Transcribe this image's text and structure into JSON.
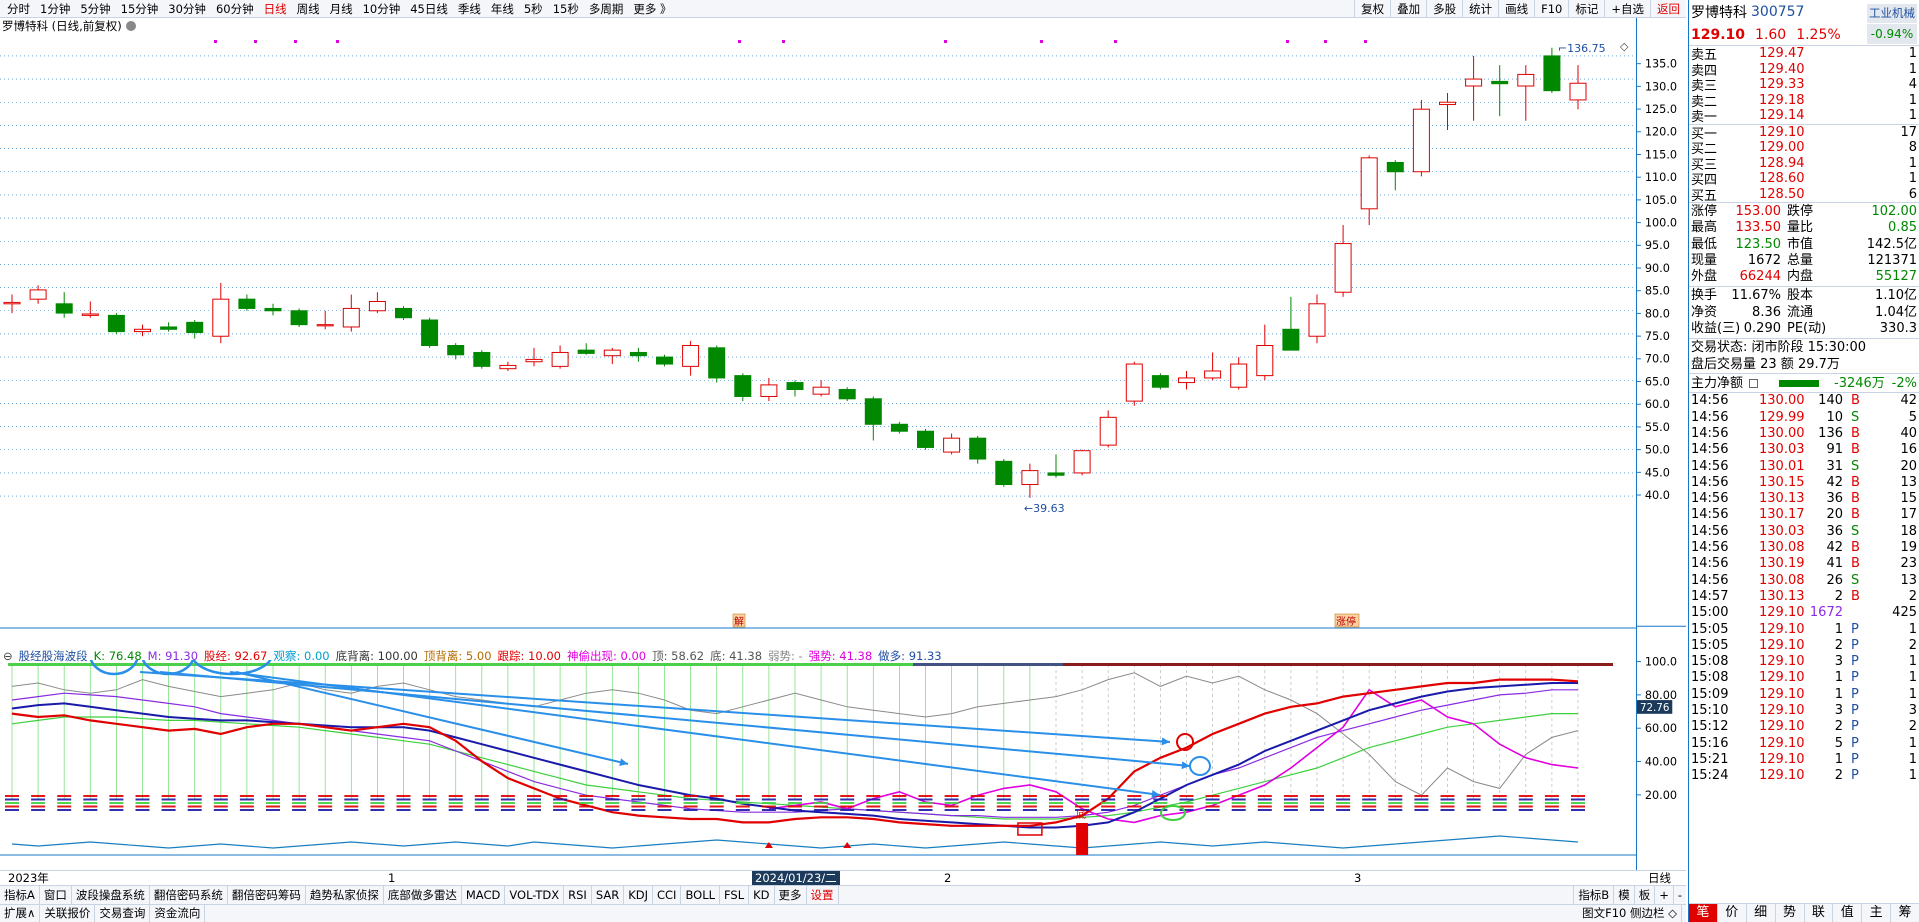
{
  "toolbar": {
    "timeframes": [
      "分时",
      "1分钟",
      "5分钟",
      "15分钟",
      "30分钟",
      "60分钟",
      "日线",
      "周线",
      "月线",
      "10分钟",
      "45日线",
      "季线",
      "年线",
      "5秒",
      "15秒",
      "多周期",
      "更多 》"
    ],
    "active_timeframe": "日线",
    "right_buttons": [
      "复权",
      "叠加",
      "多股",
      "统计",
      "画线",
      "F10",
      "标记",
      "+自选",
      "返回"
    ]
  },
  "chart": {
    "title": "罗博特科 (日线,前复权)",
    "high_label": "136.75",
    "low_label": "39.63",
    "yaxis_labels": [
      "135.0",
      "130.0",
      "125.0",
      "120.0",
      "115.0",
      "110.0",
      "105.0",
      "100.0",
      "95.0",
      "90.0",
      "85.0",
      "80.0",
      "75.0",
      "70.0",
      "65.0",
      "60.0",
      "55.0",
      "50.0",
      "45.0",
      "40.0"
    ],
    "price_min": 37,
    "price_max": 138,
    "event_markers": [
      "解",
      "涨停"
    ],
    "candles": [
      {
        "o": 81.5,
        "h": 83.5,
        "l": 79.5,
        "c": 81.8
      },
      {
        "o": 82.5,
        "h": 85.5,
        "l": 81.5,
        "c": 84.5
      },
      {
        "o": 81.5,
        "h": 84,
        "l": 78.5,
        "c": 79.5
      },
      {
        "o": 79,
        "h": 82,
        "l": 78.5,
        "c": 79.3
      },
      {
        "o": 79,
        "h": 79.5,
        "l": 75,
        "c": 75.5
      },
      {
        "o": 75.5,
        "h": 77,
        "l": 74.5,
        "c": 76
      },
      {
        "o": 76.5,
        "h": 77.5,
        "l": 75.5,
        "c": 76
      },
      {
        "o": 77.5,
        "h": 78,
        "l": 74,
        "c": 75.3
      },
      {
        "o": 74.5,
        "h": 86,
        "l": 73,
        "c": 82.5
      },
      {
        "o": 82.5,
        "h": 83.5,
        "l": 80,
        "c": 80.5
      },
      {
        "o": 80.5,
        "h": 81.5,
        "l": 79,
        "c": 80
      },
      {
        "o": 80,
        "h": 80.5,
        "l": 76.5,
        "c": 77
      },
      {
        "o": 77,
        "h": 80,
        "l": 76,
        "c": 77
      },
      {
        "o": 76.5,
        "h": 83.5,
        "l": 75.5,
        "c": 80.5
      },
      {
        "o": 80,
        "h": 84,
        "l": 79.5,
        "c": 82
      },
      {
        "o": 80.5,
        "h": 81,
        "l": 78,
        "c": 78.5
      },
      {
        "o": 78,
        "h": 78.5,
        "l": 72,
        "c": 72.5
      },
      {
        "o": 72.5,
        "h": 73,
        "l": 69.5,
        "c": 70.5
      },
      {
        "o": 71,
        "h": 71.5,
        "l": 67.5,
        "c": 68
      },
      {
        "o": 67.5,
        "h": 69,
        "l": 67,
        "c": 68.2
      },
      {
        "o": 69,
        "h": 72,
        "l": 68,
        "c": 69.5
      },
      {
        "o": 68,
        "h": 72.5,
        "l": 67.5,
        "c": 71
      },
      {
        "o": 71.5,
        "h": 73,
        "l": 70.5,
        "c": 70.8
      },
      {
        "o": 70.3,
        "h": 72,
        "l": 68.5,
        "c": 71.5
      },
      {
        "o": 71,
        "h": 72,
        "l": 69,
        "c": 70.3
      },
      {
        "o": 70,
        "h": 70.5,
        "l": 68,
        "c": 68.5
      },
      {
        "o": 68,
        "h": 73.5,
        "l": 66,
        "c": 72.5
      },
      {
        "o": 72,
        "h": 72.5,
        "l": 64.5,
        "c": 65.5
      },
      {
        "o": 66,
        "h": 66.5,
        "l": 60.5,
        "c": 61.5
      },
      {
        "o": 61.5,
        "h": 65.5,
        "l": 60.5,
        "c": 64
      },
      {
        "o": 64.5,
        "h": 65,
        "l": 61.5,
        "c": 63
      },
      {
        "o": 62,
        "h": 65,
        "l": 61.5,
        "c": 63.5
      },
      {
        "o": 63,
        "h": 63.5,
        "l": 60.5,
        "c": 61
      },
      {
        "o": 61,
        "h": 61.5,
        "l": 52,
        "c": 55.5
      },
      {
        "o": 55.5,
        "h": 56,
        "l": 53.5,
        "c": 54
      },
      {
        "o": 54,
        "h": 54.5,
        "l": 50,
        "c": 50.5
      },
      {
        "o": 49.5,
        "h": 53.5,
        "l": 49,
        "c": 52.5
      },
      {
        "o": 52.5,
        "h": 53,
        "l": 47,
        "c": 48
      },
      {
        "o": 47.5,
        "h": 48,
        "l": 42,
        "c": 42.5
      },
      {
        "o": 42.5,
        "h": 47,
        "l": 39.63,
        "c": 45.5
      },
      {
        "o": 45,
        "h": 49,
        "l": 44,
        "c": 44.5
      },
      {
        "o": 45,
        "h": 50,
        "l": 44.5,
        "c": 49.8
      },
      {
        "o": 51,
        "h": 58.5,
        "l": 50.5,
        "c": 57
      },
      {
        "o": 60.5,
        "h": 69,
        "l": 59.5,
        "c": 68.5
      },
      {
        "o": 66,
        "h": 66.5,
        "l": 63,
        "c": 63.5
      },
      {
        "o": 64.5,
        "h": 67,
        "l": 63,
        "c": 65.5
      },
      {
        "o": 65.5,
        "h": 71,
        "l": 65,
        "c": 67
      },
      {
        "o": 63.5,
        "h": 70,
        "l": 63,
        "c": 68.5
      },
      {
        "o": 66,
        "h": 77,
        "l": 65,
        "c": 72.5
      },
      {
        "o": 76,
        "h": 83,
        "l": 71.5,
        "c": 71.5
      },
      {
        "o": 74.5,
        "h": 83.5,
        "l": 73,
        "c": 81.5
      },
      {
        "o": 84,
        "h": 98.5,
        "l": 83,
        "c": 94.5
      },
      {
        "o": 102,
        "h": 113.5,
        "l": 98.5,
        "c": 113
      },
      {
        "o": 112,
        "h": 112.5,
        "l": 106,
        "c": 110
      },
      {
        "o": 110,
        "h": 125.5,
        "l": 109,
        "c": 123.5
      },
      {
        "o": 124.5,
        "h": 127,
        "l": 119,
        "c": 125
      },
      {
        "o": 128.5,
        "h": 135,
        "l": 121,
        "c": 130
      },
      {
        "o": 129.5,
        "h": 133,
        "l": 122,
        "c": 129
      },
      {
        "o": 128.5,
        "h": 133,
        "l": 121,
        "c": 131
      },
      {
        "o": 135,
        "h": 136.75,
        "l": 127,
        "c": 127.5
      },
      {
        "o": 125.5,
        "h": 133,
        "l": 123.5,
        "c": 129.1
      }
    ]
  },
  "indicator": {
    "name": "股经股海波段",
    "K": "K: 76.48",
    "M": "M: 91.30",
    "stock_label": "股经: 92.67",
    "watch": "观察: 0.00",
    "bottom_div": "底背离: 100.00",
    "top_div": "顶背离: 5.00",
    "follow": "跟踪: 10.00",
    "sacred": "神偷出现: 0.00",
    "top": "顶: 58.62",
    "bottom": "底: 41.38",
    "weak": "弱势: -",
    "strong": "强势: 41.38",
    "long": "做多: 91.33",
    "yaxis_labels": [
      "100.0",
      "80.00",
      "60.00",
      "40.00",
      "20.00"
    ],
    "current_tag": "72.76"
  },
  "date_bar": {
    "labels": [
      "2023年",
      "1",
      "2",
      "3"
    ],
    "cursor_date": "2024/01/23/二",
    "right_label": "日线"
  },
  "tabs": {
    "items": [
      "指标A",
      "窗口",
      "波段操盘系统",
      "翻倍密码系统",
      "翻倍密码筹码",
      "趋势私家侦探",
      "底部做多雷达",
      "MACD",
      "VOL-TDX",
      "RSI",
      "SAR",
      "KDJ",
      "CCI",
      "BOLL",
      "FSL",
      "KD",
      "更多",
      "设置"
    ],
    "active": "设置",
    "right": [
      "指标B",
      "模",
      "板",
      "+",
      "-"
    ]
  },
  "bottom_bar": {
    "items": [
      "扩展∧",
      "关联报价",
      "交易查询",
      "资金流向"
    ],
    "right": "图文F10 侧边栏 ◇"
  },
  "quote": {
    "name": "罗博特科",
    "code": "300757",
    "industry": "工业机械",
    "price": "129.10",
    "change": "1.60",
    "change_pct": "1.25%",
    "industry_change": "-0.94%",
    "asks": [
      {
        "label": "卖五",
        "price": "129.47",
        "vol": "1"
      },
      {
        "label": "卖四",
        "price": "129.40",
        "vol": "1"
      },
      {
        "label": "卖三",
        "price": "129.33",
        "vol": "4"
      },
      {
        "label": "卖二",
        "price": "129.18",
        "vol": "1"
      },
      {
        "label": "卖一",
        "price": "129.14",
        "vol": "1"
      }
    ],
    "bids": [
      {
        "label": "买一",
        "price": "129.10",
        "vol": "17"
      },
      {
        "label": "买二",
        "price": "129.00",
        "vol": "8"
      },
      {
        "label": "买三",
        "price": "128.94",
        "vol": "1"
      },
      {
        "label": "买四",
        "price": "128.60",
        "vol": "1"
      },
      {
        "label": "买五",
        "price": "128.50",
        "vol": "6"
      }
    ],
    "stats": [
      {
        "l1": "涨停",
        "v1": "153.00",
        "c1": "red",
        "l2": "跌停",
        "v2": "102.00",
        "c2": "green"
      },
      {
        "l1": "最高",
        "v1": "133.50",
        "c1": "red",
        "l2": "量比",
        "v2": "0.85",
        "c2": "green"
      },
      {
        "l1": "最低",
        "v1": "123.50",
        "c1": "green",
        "l2": "市值",
        "v2": "142.5亿",
        "c2": ""
      },
      {
        "l1": "现量",
        "v1": "1672",
        "c1": "",
        "l2": "总量",
        "v2": "121371",
        "c2": ""
      },
      {
        "l1": "外盘",
        "v1": "66244",
        "c1": "red",
        "l2": "内盘",
        "v2": "55127",
        "c2": "green"
      }
    ],
    "stats2": [
      {
        "l1": "换手",
        "v1": "11.67%",
        "l2": "股本",
        "v2": "1.10亿"
      },
      {
        "l1": "净资",
        "v1": "8.36",
        "l2": "流通",
        "v2": "1.04亿"
      },
      {
        "l1": "收益(三)",
        "v1": "0.290",
        "l2": "PE(动)",
        "v2": "330.3"
      }
    ],
    "trade_status": "交易状态: 闭市阶段 15:30:00",
    "after_hours": "盘后交易量 23 额 29.7万",
    "main_flow_label": "主力净额",
    "main_flow_value": "-3246万",
    "main_flow_pct": "-2%",
    "ticks": [
      {
        "t": "14:56",
        "p": "130.00",
        "v": "140",
        "s": "B",
        "n": "42"
      },
      {
        "t": "14:56",
        "p": "129.99",
        "v": "10",
        "s": "S",
        "n": "5"
      },
      {
        "t": "14:56",
        "p": "130.00",
        "v": "136",
        "s": "B",
        "n": "40"
      },
      {
        "t": "14:56",
        "p": "130.03",
        "v": "91",
        "s": "B",
        "n": "16"
      },
      {
        "t": "14:56",
        "p": "130.01",
        "v": "31",
        "s": "S",
        "n": "20"
      },
      {
        "t": "14:56",
        "p": "130.15",
        "v": "42",
        "s": "B",
        "n": "13"
      },
      {
        "t": "14:56",
        "p": "130.13",
        "v": "36",
        "s": "B",
        "n": "15"
      },
      {
        "t": "14:56",
        "p": "130.17",
        "v": "20",
        "s": "B",
        "n": "17"
      },
      {
        "t": "14:56",
        "p": "130.03",
        "v": "36",
        "s": "S",
        "n": "18"
      },
      {
        "t": "14:56",
        "p": "130.08",
        "v": "42",
        "s": "B",
        "n": "19"
      },
      {
        "t": "14:56",
        "p": "130.19",
        "v": "41",
        "s": "B",
        "n": "23"
      },
      {
        "t": "14:56",
        "p": "130.08",
        "v": "26",
        "s": "S",
        "n": "13"
      },
      {
        "t": "14:57",
        "p": "130.13",
        "v": "2",
        "s": "B",
        "n": "2"
      },
      {
        "t": "15:00",
        "p": "129.10",
        "v": "1672",
        "s": "",
        "n": "425"
      },
      {
        "t": "15:05",
        "p": "129.10",
        "v": "1",
        "s": "P",
        "n": "1"
      },
      {
        "t": "15:05",
        "p": "129.10",
        "v": "2",
        "s": "P",
        "n": "2"
      },
      {
        "t": "15:08",
        "p": "129.10",
        "v": "3",
        "s": "P",
        "n": "1"
      },
      {
        "t": "15:08",
        "p": "129.10",
        "v": "1",
        "s": "P",
        "n": "1"
      },
      {
        "t": "15:09",
        "p": "129.10",
        "v": "1",
        "s": "P",
        "n": "1"
      },
      {
        "t": "15:10",
        "p": "129.10",
        "v": "3",
        "s": "P",
        "n": "3"
      },
      {
        "t": "15:12",
        "p": "129.10",
        "v": "2",
        "s": "P",
        "n": "2"
      },
      {
        "t": "15:16",
        "p": "129.10",
        "v": "5",
        "s": "P",
        "n": "1"
      },
      {
        "t": "15:21",
        "p": "129.10",
        "v": "1",
        "s": "P",
        "n": "1"
      },
      {
        "t": "15:24",
        "p": "129.10",
        "v": "2",
        "s": "P",
        "n": "1"
      }
    ],
    "bottom_tabs": [
      "笔",
      "价",
      "细",
      "势",
      "联",
      "值",
      "主",
      "筹"
    ],
    "bottom_active": "笔"
  },
  "colors": {
    "up": "#e00000",
    "down": "#008800",
    "grid": "#1677c8",
    "accent_blue": "#2a8fe8"
  }
}
